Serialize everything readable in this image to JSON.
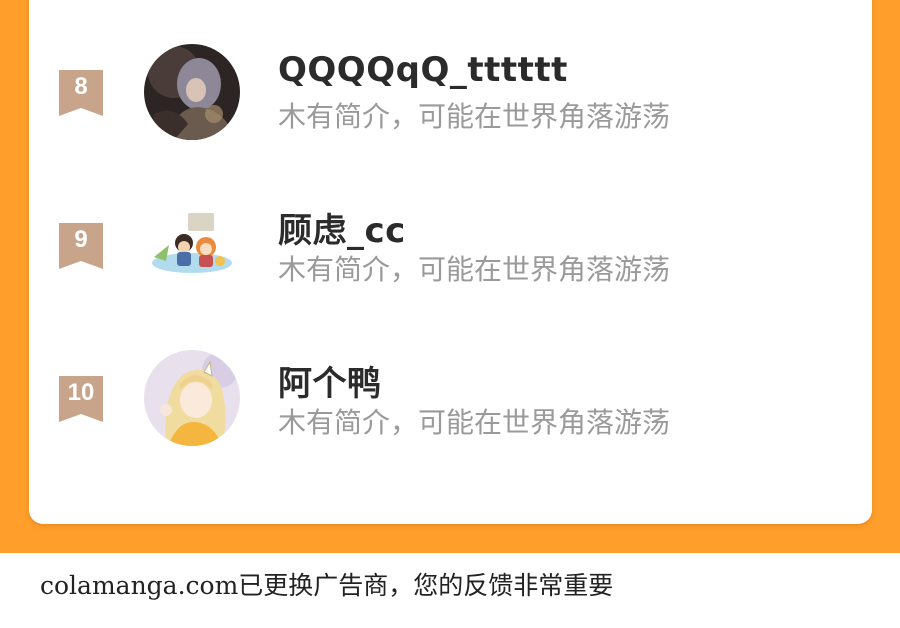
{
  "colors": {
    "frame": "#FF9E2A",
    "card": "#ffffff",
    "badge": "#C8A58A",
    "name": "#2b2b2b",
    "bio": "#9a9a9a"
  },
  "ranking": {
    "items": [
      {
        "rank": "8",
        "name": "QQQQqQ_tttttt",
        "bio": "木有简介，可能在世界角落游荡",
        "avatar": "dark-illustrated-avatar"
      },
      {
        "rank": "9",
        "name": "顾虑_cc",
        "bio": "木有简介，可能在世界角落游荡",
        "avatar": "chibi-characters-avatar"
      },
      {
        "rank": "10",
        "name": "阿个鸭",
        "bio": "木有简介，可能在世界角落游荡",
        "avatar": "blonde-anime-girl-avatar"
      }
    ]
  },
  "footer": {
    "notice": "colamanga.com已更换广告商，您的反馈非常重要"
  }
}
